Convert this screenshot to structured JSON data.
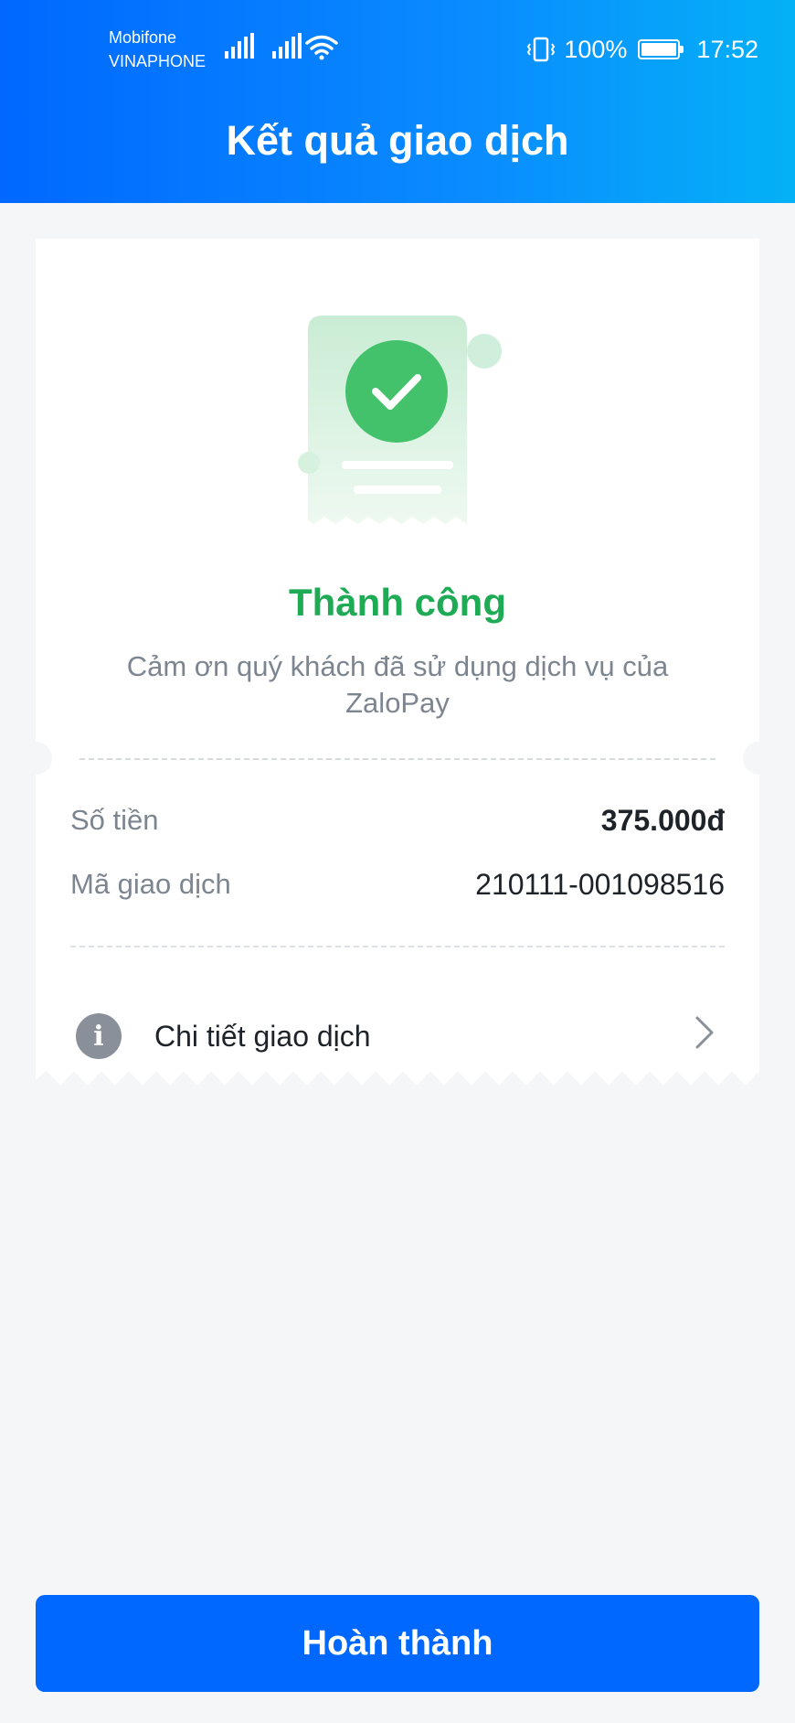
{
  "status_bar": {
    "carrier_1": "Mobifone",
    "carrier_2": "VINAPHONE",
    "battery": "100%",
    "time": "17:52"
  },
  "header": {
    "title": "Kết quả giao dịch"
  },
  "result": {
    "status": "Thành công",
    "message": "Cảm ơn quý khách đã sử dụng dịch vụ của ZaloPay",
    "status_color": "#1faa55"
  },
  "details": [
    {
      "label": "Số tiền",
      "value": "375.000đ"
    },
    {
      "label": "Mã giao dịch",
      "value": "210111-001098516"
    }
  ],
  "detail_link": {
    "label": "Chi tiết giao dịch",
    "icon": "info-icon",
    "chevron": "chevron-right-icon"
  },
  "footer": {
    "done_label": "Hoàn thành"
  },
  "colors": {
    "brand": "#0068ff",
    "success": "#1faa55",
    "background": "#f4f6f8"
  }
}
